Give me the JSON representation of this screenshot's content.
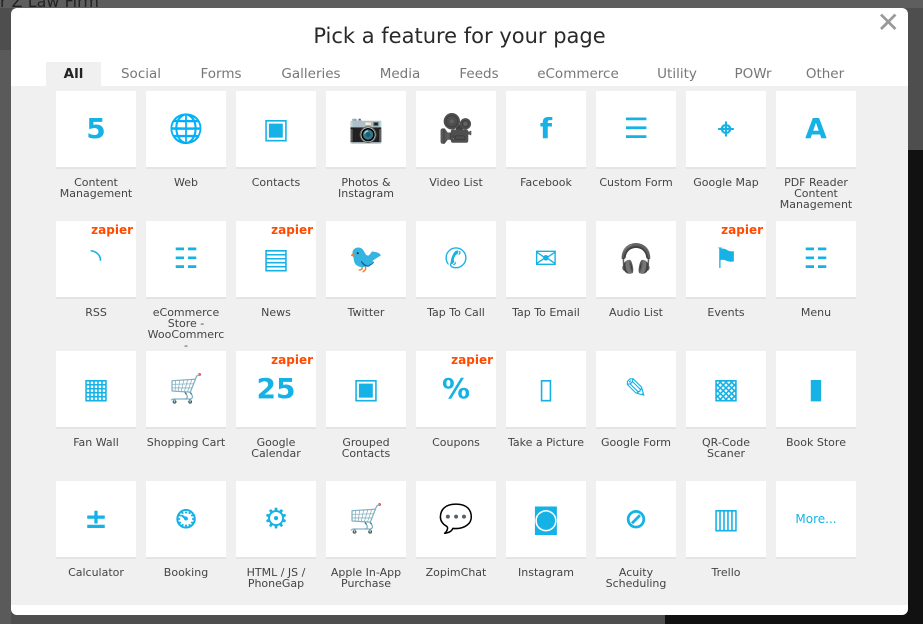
{
  "background": {
    "page_title_fragment": "r Z Law Firm"
  },
  "modal": {
    "title": "Pick a feature for your page",
    "close_icon": "close-icon",
    "accent_color": "#16b2e6",
    "tabs": [
      {
        "label": "All",
        "active": true
      },
      {
        "label": "Social"
      },
      {
        "label": "Forms"
      },
      {
        "label": "Galleries"
      },
      {
        "label": "Media"
      },
      {
        "label": "Feeds"
      },
      {
        "label": "eCommerce"
      },
      {
        "label": "Utility"
      },
      {
        "label": "POWr"
      },
      {
        "label": "Other"
      }
    ],
    "badge_label": "zapier",
    "features": [
      {
        "label": "Content Management",
        "icon": "html5-icon",
        "glyph": "5"
      },
      {
        "label": "Web",
        "icon": "globe-icon",
        "glyph": "🌐"
      },
      {
        "label": "Contacts",
        "icon": "contacts-book-icon",
        "glyph": "▣"
      },
      {
        "label": "Photos & Instagram",
        "icon": "camera-icon",
        "glyph": "📷"
      },
      {
        "label": "Video List",
        "icon": "video-camera-icon",
        "glyph": "🎥"
      },
      {
        "label": "Facebook",
        "icon": "facebook-icon",
        "glyph": "f"
      },
      {
        "label": "Custom Form",
        "icon": "form-star-icon",
        "glyph": "☰"
      },
      {
        "label": "Google Map",
        "icon": "map-pin-icon",
        "glyph": "⌖"
      },
      {
        "label": "PDF Reader Content Management",
        "icon": "pdf-reader-icon",
        "glyph": "A"
      },
      {
        "label": "RSS",
        "icon": "rss-icon",
        "glyph": "◝",
        "zapier": true
      },
      {
        "label": "eCommerce Store - WooCommerc -",
        "icon": "clipboard-list-icon",
        "glyph": "☷"
      },
      {
        "label": "News",
        "icon": "newspaper-icon",
        "glyph": "▤",
        "zapier": true
      },
      {
        "label": "Twitter",
        "icon": "twitter-bird-icon",
        "glyph": "🐦"
      },
      {
        "label": "Tap To Call",
        "icon": "phone-icon",
        "glyph": "✆"
      },
      {
        "label": "Tap To Email",
        "icon": "envelope-icon",
        "glyph": "✉"
      },
      {
        "label": "Audio List",
        "icon": "headphones-icon",
        "glyph": "🎧"
      },
      {
        "label": "Events",
        "icon": "flag-icon",
        "glyph": "⚑",
        "zapier": true
      },
      {
        "label": "Menu",
        "icon": "menu-list-icon",
        "glyph": "☷"
      },
      {
        "label": "Fan Wall",
        "icon": "brick-wall-icon",
        "glyph": "▦"
      },
      {
        "label": "Shopping Cart",
        "icon": "shopping-cart-icon",
        "glyph": "🛒"
      },
      {
        "label": "Google Calendar",
        "icon": "calendar-25-icon",
        "glyph": "25",
        "zapier": true
      },
      {
        "label": "Grouped Contacts",
        "icon": "grouped-contacts-icon",
        "glyph": "▣"
      },
      {
        "label": "Coupons",
        "icon": "coupon-percent-icon",
        "glyph": "%",
        "zapier": true
      },
      {
        "label": "Take a Picture",
        "icon": "phone-camera-icon",
        "glyph": "▯"
      },
      {
        "label": "Google Form",
        "icon": "form-pencil-icon",
        "glyph": "✎"
      },
      {
        "label": "QR-Code Scaner",
        "icon": "qr-code-icon",
        "glyph": "▩"
      },
      {
        "label": "Book Store",
        "icon": "book-icon",
        "glyph": "▮"
      },
      {
        "label": "Calculator",
        "icon": "calculator-icon",
        "glyph": "±"
      },
      {
        "label": "Booking",
        "icon": "booking-clock-icon",
        "glyph": "⏲"
      },
      {
        "label": "HTML / JS / PhoneGap",
        "icon": "html-js-gear-icon",
        "glyph": "⚙"
      },
      {
        "label": "Apple In-App Purchase",
        "icon": "cart-icon",
        "glyph": "🛒"
      },
      {
        "label": "ZopimChat",
        "icon": "chat-bubbles-icon",
        "glyph": "💬"
      },
      {
        "label": "Instagram",
        "icon": "instagram-icon",
        "glyph": "◙"
      },
      {
        "label": "Acuity Scheduling",
        "icon": "acuity-icon",
        "glyph": "⊘"
      },
      {
        "label": "Trello",
        "icon": "trello-icon",
        "glyph": "▥"
      }
    ],
    "more_label": "More..."
  }
}
